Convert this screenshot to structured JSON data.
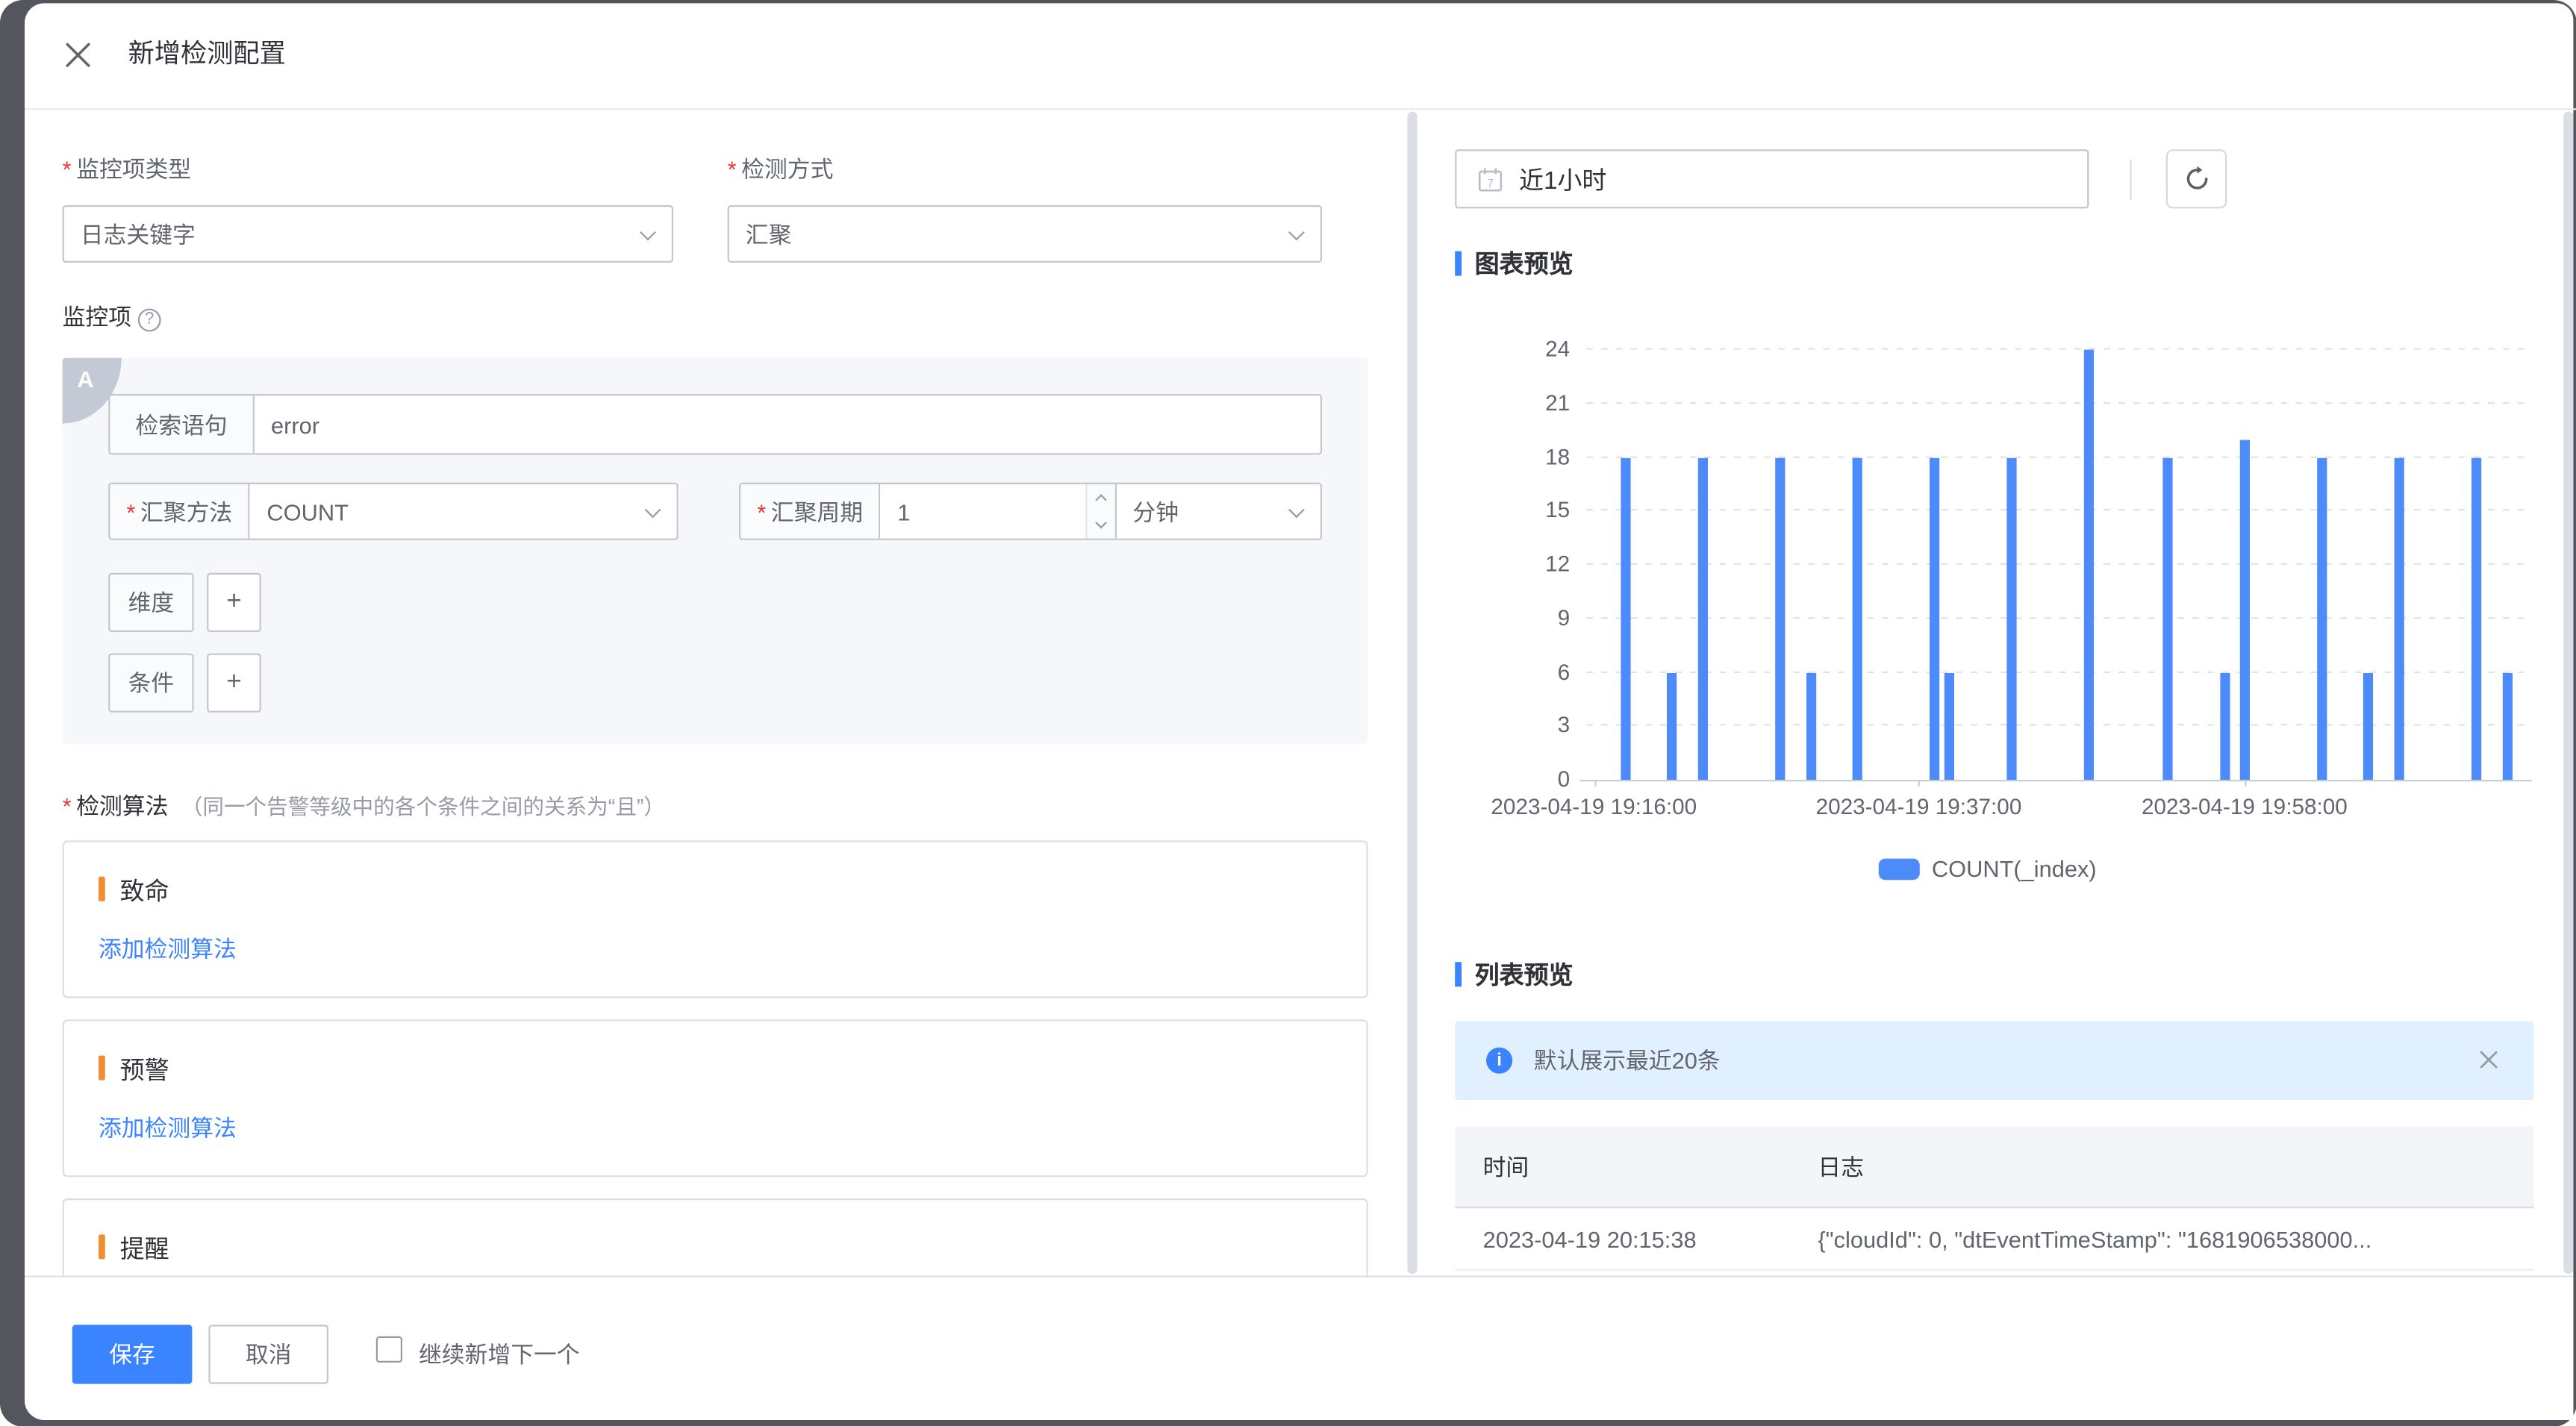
{
  "colors": {
    "accent": "#3A84FF",
    "bar": "#4C8BF9",
    "level_orange": "#F08E33",
    "required": "#EA3636"
  },
  "ui": {
    "required_mark": "*",
    "plus": "+"
  },
  "drawer": {
    "title": "新增检测配置"
  },
  "form": {
    "monitor_type": {
      "label": "监控项类型",
      "value": "日志关键字"
    },
    "detect_method": {
      "label": "检测方式",
      "value": "汇聚"
    },
    "monitor_item": {
      "label": "监控项",
      "badge": "A",
      "query": {
        "label": "检索语句",
        "value": "error"
      },
      "agg_method": {
        "label": "汇聚方法",
        "value": "COUNT"
      },
      "agg_period": {
        "label": "汇聚周期",
        "value": "1",
        "unit": "分钟"
      },
      "dimension": {
        "label": "维度",
        "add": "+"
      },
      "condition": {
        "label": "条件",
        "add": "+"
      }
    },
    "algorithm": {
      "label": "检测算法",
      "hint": "（同一个告警等级中的各个条件之间的关系为“且”）",
      "levels": [
        {
          "name": "致命",
          "link": "添加检测算法"
        },
        {
          "name": "预警",
          "link": "添加检测算法"
        },
        {
          "name": "提醒",
          "link": ""
        }
      ]
    }
  },
  "footer": {
    "save": "保存",
    "cancel": "取消",
    "continue_label": "继续新增下一个"
  },
  "preview": {
    "time_range": "近1小时",
    "chart_title": "图表预览",
    "list_title": "列表预览",
    "alert_text": "默认展示最近20条",
    "table": {
      "columns": [
        "时间",
        "日志"
      ],
      "rows": [
        [
          "2023-04-19 20:15:38",
          "{\"cloudId\": 0, \"dtEventTimeStamp\": \"1681906538000..."
        ]
      ]
    }
  },
  "chart_data": {
    "type": "bar",
    "title": "图表预览",
    "xlabel": "",
    "ylabel": "",
    "ylim": [
      0,
      24
    ],
    "yticks": [
      0,
      3,
      6,
      9,
      12,
      15,
      18,
      21,
      24
    ],
    "grid": "horizontal-dashed",
    "legend_position": "bottom",
    "legend": [
      "COUNT(_index)"
    ],
    "x_ticks": [
      {
        "label": "2023-04-19 19:16:00",
        "pos": 0.008
      },
      {
        "label": "2023-04-19 19:37:00",
        "pos": 0.352
      },
      {
        "label": "2023-04-19 19:58:00",
        "pos": 0.697
      }
    ],
    "bars": [
      {
        "time": "19:18",
        "value": 18,
        "pos": 0.041
      },
      {
        "time": "19:21",
        "value": 6,
        "pos": 0.09
      },
      {
        "time": "19:23",
        "value": 18,
        "pos": 0.123
      },
      {
        "time": "19:28",
        "value": 18,
        "pos": 0.205
      },
      {
        "time": "19:30",
        "value": 6,
        "pos": 0.238
      },
      {
        "time": "19:33",
        "value": 18,
        "pos": 0.287
      },
      {
        "time": "19:38",
        "value": 18,
        "pos": 0.369
      },
      {
        "time": "19:39",
        "value": 6,
        "pos": 0.385
      },
      {
        "time": "19:43",
        "value": 18,
        "pos": 0.451
      },
      {
        "time": "19:48",
        "value": 24,
        "pos": 0.533
      },
      {
        "time": "19:53",
        "value": 18,
        "pos": 0.615
      },
      {
        "time": "19:57",
        "value": 6,
        "pos": 0.676
      },
      {
        "time": "19:58",
        "value": 19,
        "pos": 0.697
      },
      {
        "time": "20:03",
        "value": 18,
        "pos": 0.779
      },
      {
        "time": "20:06",
        "value": 6,
        "pos": 0.828
      },
      {
        "time": "20:08",
        "value": 18,
        "pos": 0.861
      },
      {
        "time": "20:13",
        "value": 18,
        "pos": 0.943
      },
      {
        "time": "20:15",
        "value": 6,
        "pos": 0.975
      }
    ]
  }
}
